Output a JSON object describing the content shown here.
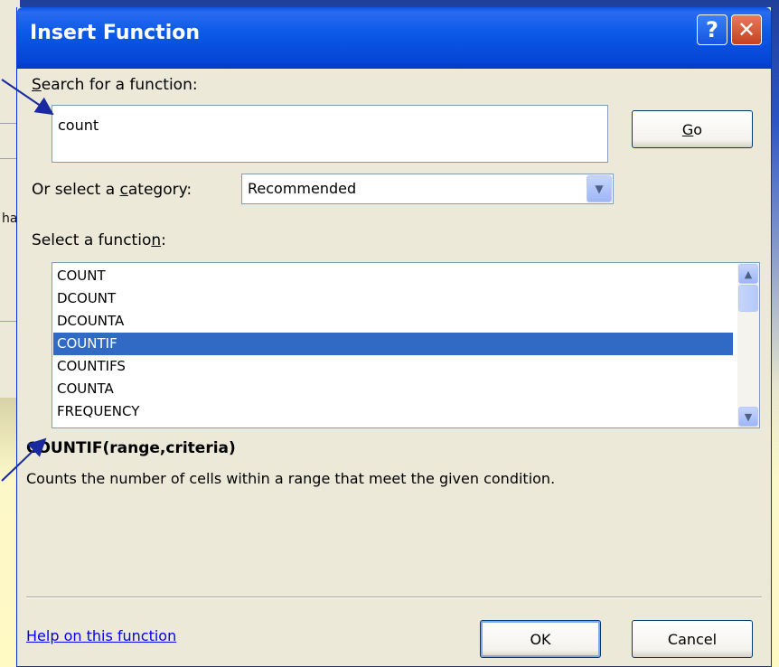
{
  "background": {
    "partial_text": "ha"
  },
  "dialog": {
    "title": "Insert Function",
    "help_glyph": "?",
    "close_glyph": "✕",
    "search": {
      "label_prefix": "",
      "label_access": "S",
      "label_rest": "earch for a function:",
      "value": "count"
    },
    "go_button": {
      "access": "G",
      "rest": "o"
    },
    "category": {
      "label_prefix": "Or select a ",
      "label_access": "c",
      "label_rest": "ategory:",
      "selected": "Recommended"
    },
    "function_list": {
      "label_prefix": "Select a functio",
      "label_access": "n",
      "label_rest": ":",
      "items": [
        "COUNT",
        "DCOUNT",
        "DCOUNTA",
        "COUNTIF",
        "COUNTIFS",
        "COUNTA",
        "FREQUENCY"
      ],
      "selected_index": 3
    },
    "signature": "COUNTIF(range,criteria)",
    "description": "Counts the number of cells within a range that meet the given condition.",
    "help_link": "Help on this function",
    "ok_label": "OK",
    "cancel_label": "Cancel"
  }
}
